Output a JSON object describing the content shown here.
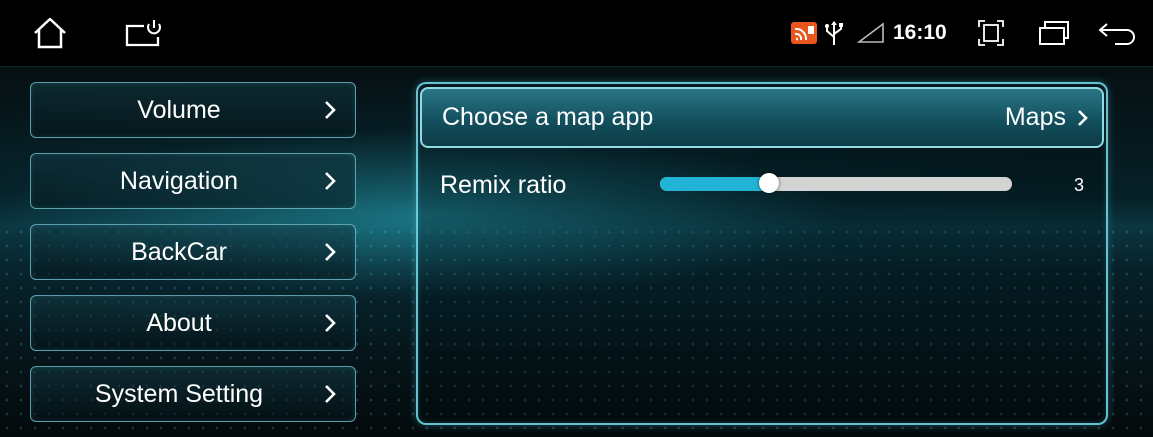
{
  "status_bar": {
    "time": "16:10",
    "icons": [
      "home-icon",
      "power-monitor-icon",
      "screen-cast-icon",
      "usb-icon",
      "cellular-signal-icon",
      "screenshot-icon",
      "recent-apps-icon",
      "back-icon"
    ]
  },
  "sidebar": {
    "items": [
      {
        "label": "Volume"
      },
      {
        "label": "Navigation"
      },
      {
        "label": "BackCar"
      },
      {
        "label": "About"
      },
      {
        "label": "System Setting"
      }
    ]
  },
  "settings": {
    "map_app": {
      "title": "Choose a map app",
      "value": "Maps"
    },
    "remix_ratio": {
      "label": "Remix ratio",
      "value": "3",
      "level_fraction": 0.31
    }
  },
  "colors": {
    "accent": "#22b4d4",
    "border": "#6ed7e6",
    "track": "#d3d3d3",
    "cast_icon": "#e8561c"
  }
}
